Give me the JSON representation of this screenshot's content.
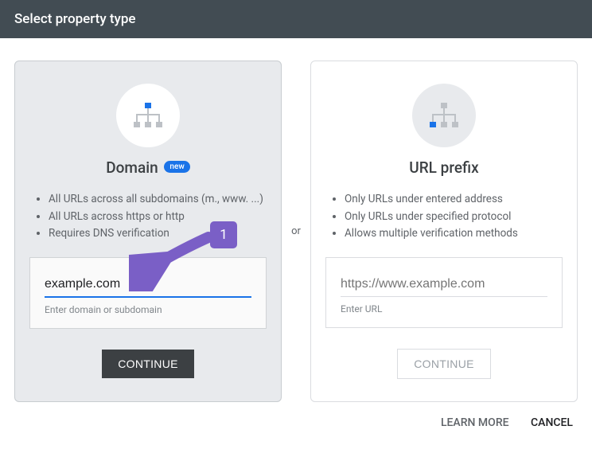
{
  "header": {
    "title": "Select property type"
  },
  "separator": "or",
  "domain_card": {
    "title": "Domain",
    "badge": "new",
    "bullets": [
      "All URLs across all subdomains (m., www. ...)",
      "All URLs across https or http",
      "Requires DNS verification"
    ],
    "input_value": "example.com",
    "hint": "Enter domain or subdomain",
    "button": "CONTINUE"
  },
  "url_card": {
    "title": "URL prefix",
    "bullets": [
      "Only URLs under entered address",
      "Only URLs under specified protocol",
      "Allows multiple verification methods"
    ],
    "input_placeholder": "https://www.example.com",
    "hint": "Enter URL",
    "button": "CONTINUE"
  },
  "footer": {
    "learn": "LEARN MORE",
    "cancel": "CANCEL"
  },
  "annotation": {
    "num": "1"
  }
}
